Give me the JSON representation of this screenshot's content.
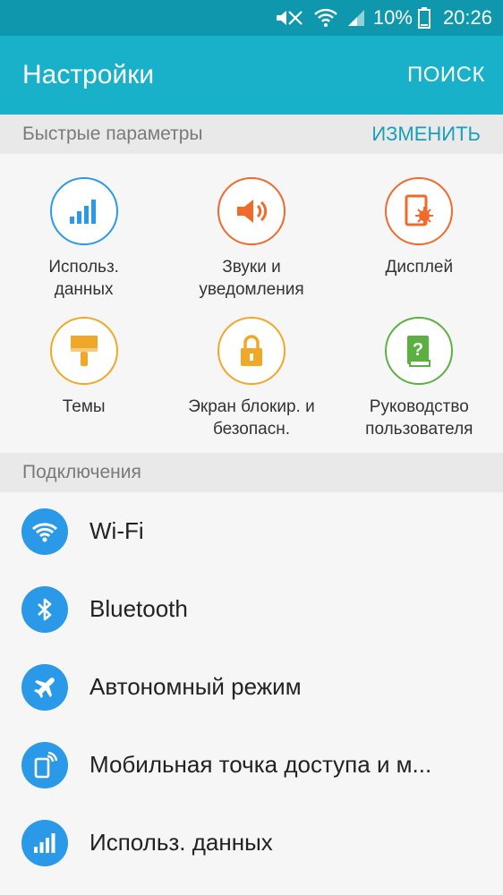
{
  "status_bar": {
    "battery": "10%",
    "time": "20:26",
    "icons": [
      "mute-icon",
      "wifi-icon",
      "signal-icon",
      "battery-icon"
    ]
  },
  "app_bar": {
    "title": "Настройки",
    "search_label": "ПОИСК"
  },
  "quick_settings": {
    "header": "Быстрые параметры",
    "edit_label": "ИЗМЕНИТЬ",
    "items": [
      {
        "label": "Использ.\nданных",
        "icon": "data-usage-icon",
        "color": "#2a9ae8"
      },
      {
        "label": "Звуки и\nуведомления",
        "icon": "sound-icon",
        "color": "#f06a2c"
      },
      {
        "label": "Дисплей",
        "icon": "display-icon",
        "color": "#f06a2c"
      },
      {
        "label": "Темы",
        "icon": "themes-icon",
        "color": "#f0a828"
      },
      {
        "label": "Экран блокир. и\nбезопасн.",
        "icon": "lock-icon",
        "color": "#f0a828"
      },
      {
        "label": "Руководство\nпользователя",
        "icon": "user-manual-icon",
        "color": "#5bb13f"
      }
    ]
  },
  "connections": {
    "header": "Подключения",
    "items": [
      {
        "label": "Wi-Fi",
        "icon": "wifi-icon"
      },
      {
        "label": "Bluetooth",
        "icon": "bluetooth-icon"
      },
      {
        "label": "Автономный режим",
        "icon": "airplane-icon"
      },
      {
        "label": "Мобильная точка доступа и м...",
        "icon": "hotspot-icon"
      },
      {
        "label": "Использ. данных",
        "icon": "data-usage-icon"
      }
    ]
  },
  "colors": {
    "status_bar": "#0f97ad",
    "app_bar": "#18b1c9",
    "accent": "#1b9fb8",
    "list_icon_bg": "#2a9ae8"
  }
}
